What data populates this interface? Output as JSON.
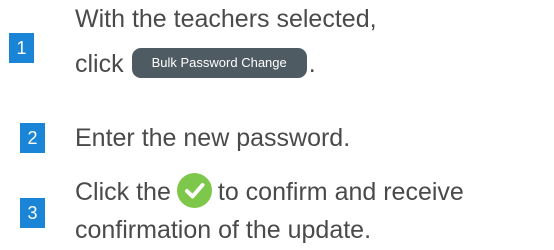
{
  "steps": [
    {
      "number": "1",
      "line1": "With the teachers selected,",
      "line2_prefix": "click",
      "button_label": "Bulk Password Change",
      "line2_suffix": "."
    },
    {
      "number": "2",
      "text": "Enter the new password."
    },
    {
      "number": "3",
      "line1_prefix": "Click the",
      "icon": "checkmark-circle-icon",
      "line1_suffix": "to confirm and receive",
      "line2": "confirmation of the update."
    }
  ],
  "colors": {
    "badge": "#1a85d6",
    "text": "#4a4a4a",
    "button_bg": "#4f5b63",
    "check_bg": "#7dc74a"
  }
}
